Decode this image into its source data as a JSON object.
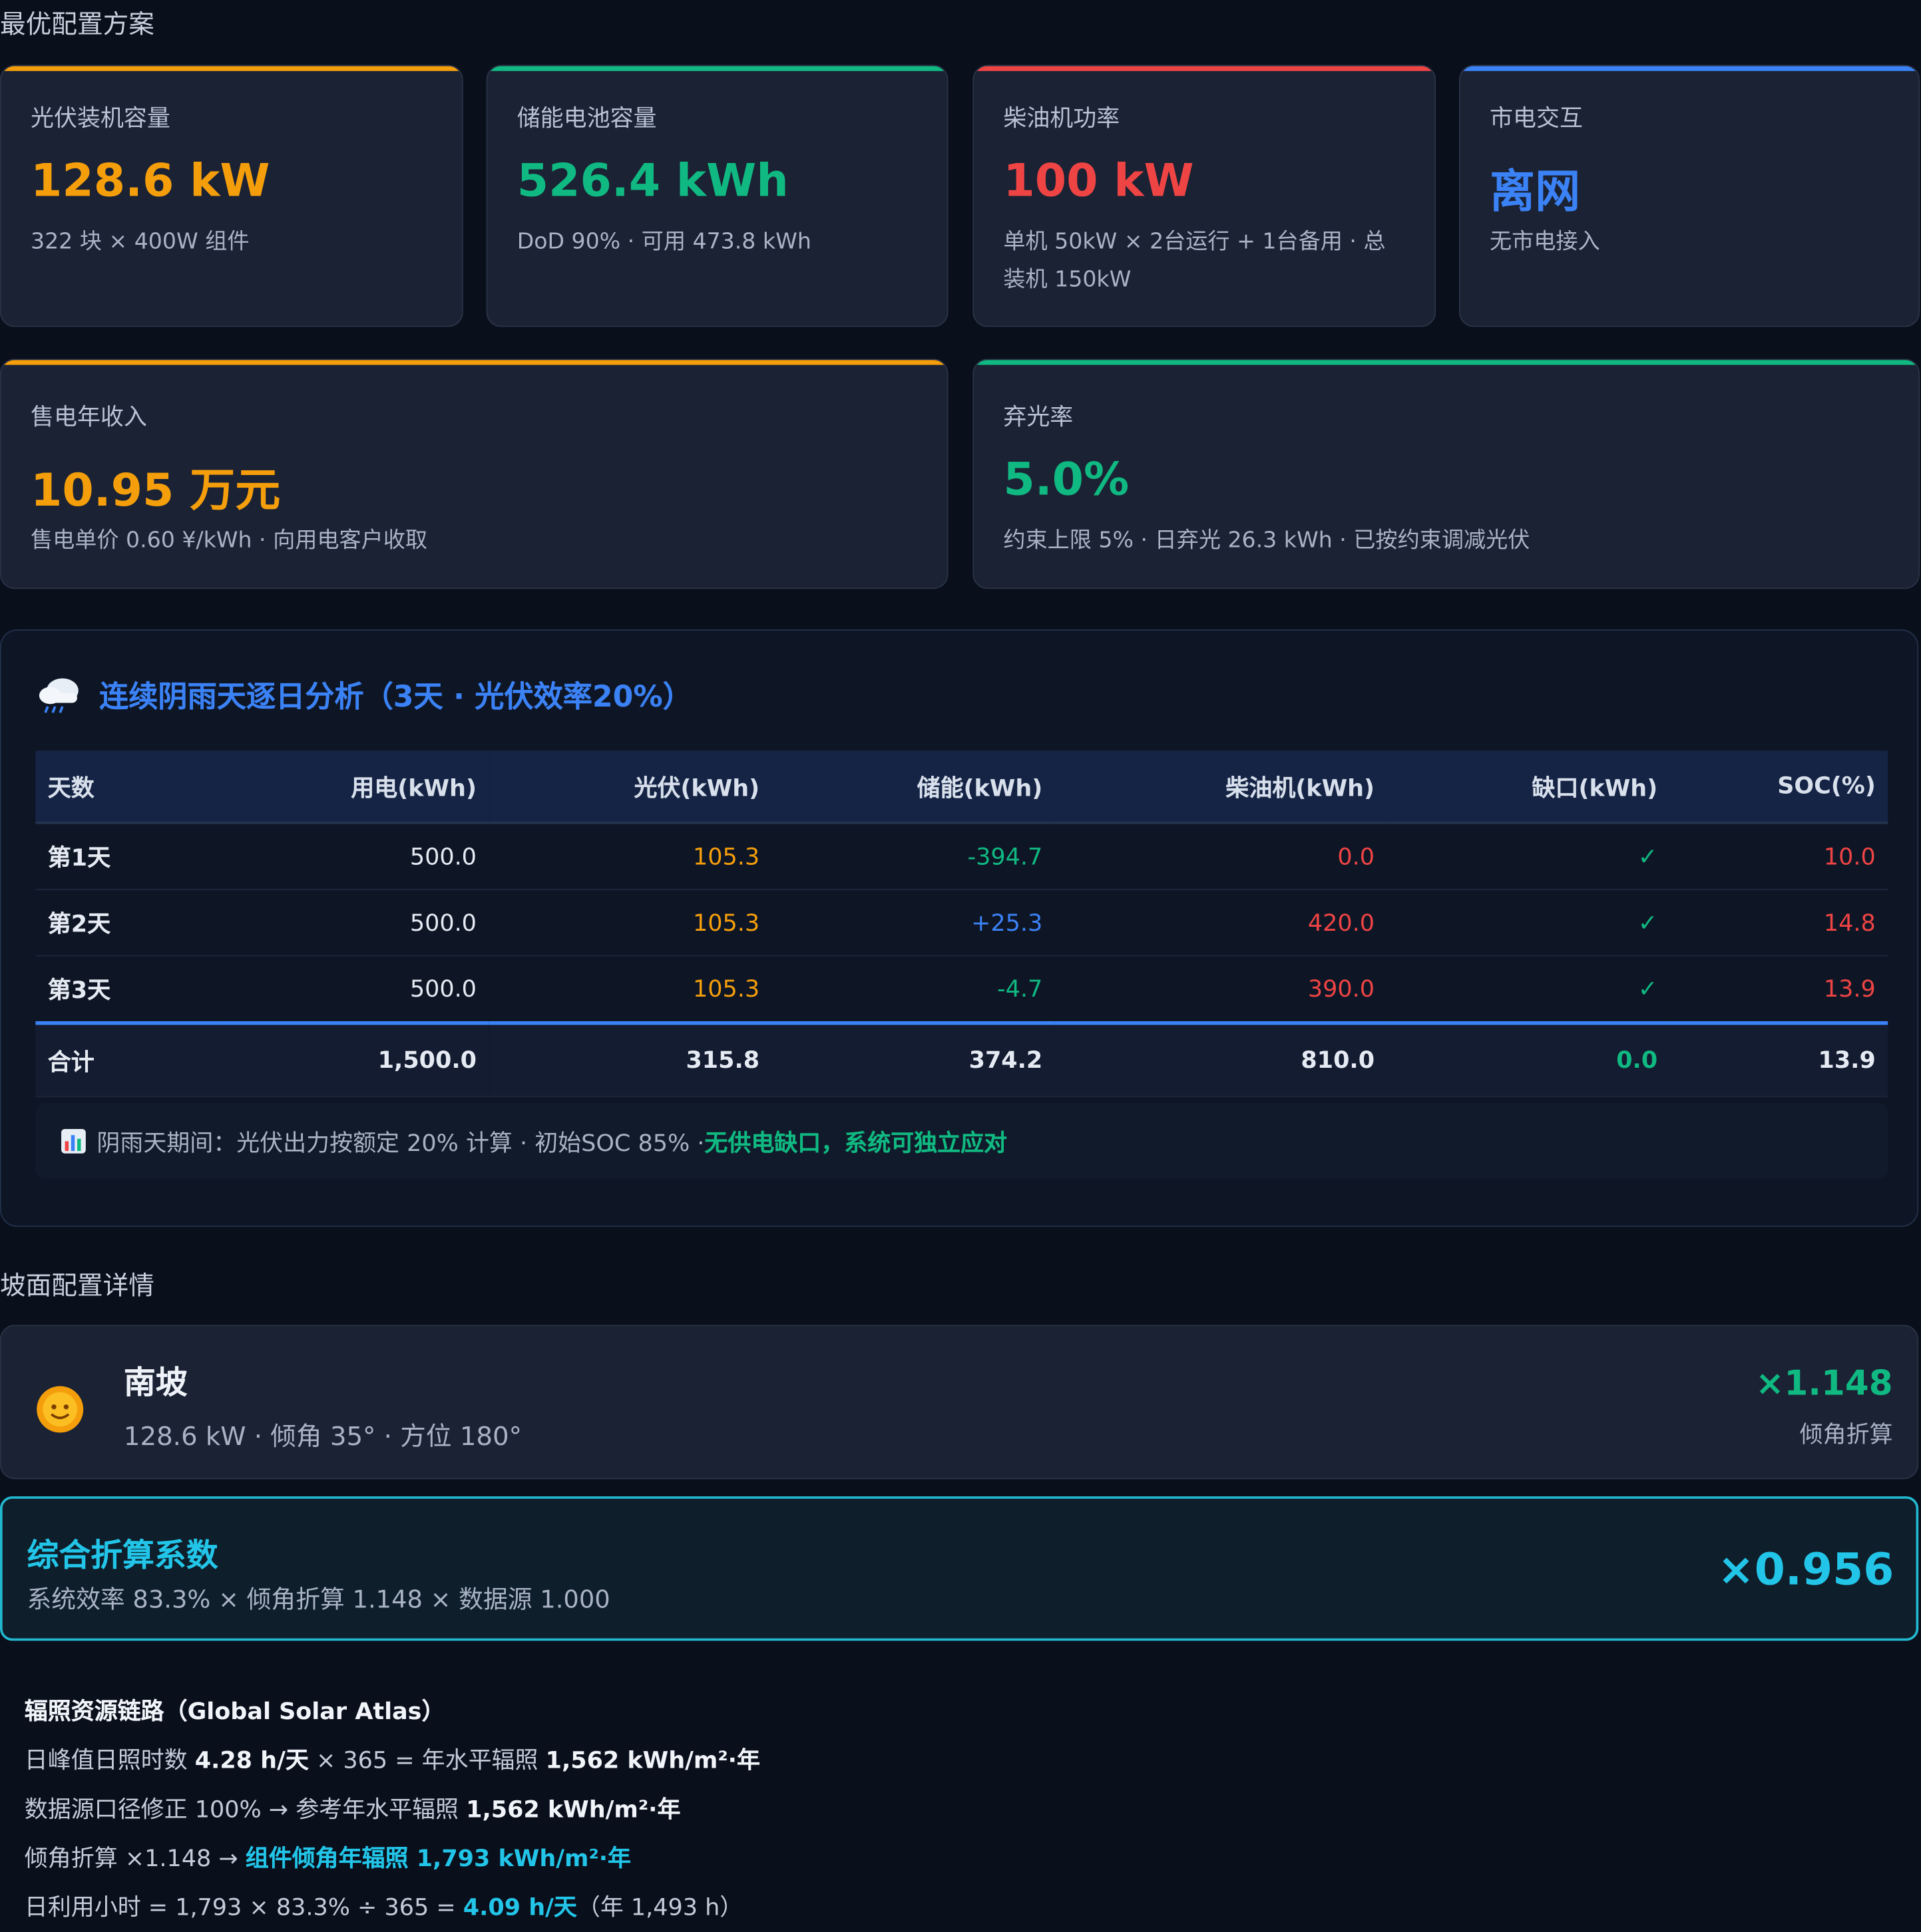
{
  "sections": {
    "optimal": "最优配置方案",
    "slope": "坡面配置详情"
  },
  "kpis": [
    {
      "label": "光伏装机容量",
      "value": "128.6 kW",
      "sub": "322 块 × 400W 组件",
      "color": "#f59e0b"
    },
    {
      "label": "储能电池容量",
      "value": "526.4 kWh",
      "sub": "DoD 90% · 可用 473.8 kWh",
      "color": "#10b981"
    },
    {
      "label": "柴油机功率",
      "value": "100 kW",
      "sub": "单机 50kW × 2台运行 + 1台备用 · 总装机 150kW",
      "color": "#ef4444"
    },
    {
      "label": "市电交互",
      "value": "离网",
      "sub": "无市电接入",
      "color": "#3b82f6"
    },
    {
      "label": "售电年收入",
      "value": "10.95 万元",
      "sub": "售电单价 0.60 ¥/kWh · 向用电客户收取",
      "color": "#f59e0b"
    },
    {
      "label": "弃光率",
      "value": "5.0%",
      "sub": "约束上限 5% · 日弃光 26.3 kWh · 已按约束调减光伏",
      "color": "#10b981"
    }
  ],
  "rainy": {
    "icon": "cloud-rain-icon",
    "title": "连续阴雨天逐日分析（3天 · 光伏效率20%）",
    "headers": [
      "天数",
      "用电(kWh)",
      "光伏(kWh)",
      "储能(kWh)",
      "柴油机(kWh)",
      "缺口(kWh)",
      "SOC(%)"
    ],
    "rows": [
      [
        "第1天",
        "500.0",
        "105.3",
        "-394.7",
        "0.0",
        "✓",
        "10.0"
      ],
      [
        "第2天",
        "500.0",
        "105.3",
        "+25.3",
        "420.0",
        "✓",
        "14.8"
      ],
      [
        "第3天",
        "500.0",
        "105.3",
        "-4.7",
        "390.0",
        "✓",
        "13.9"
      ]
    ],
    "total": [
      "合计",
      "1,500.0",
      "315.8",
      "374.2",
      "810.0",
      "0.0",
      "13.9"
    ],
    "note_prefix": "阴雨天期间：光伏出力按额定 20% 计算 · 初始SOC 85% · ",
    "note_highlight": "无供电缺口，系统可独立应对"
  },
  "slope": {
    "name": "南坡",
    "detail": "128.6 kW · 倾角 35° · 方位 180°",
    "factor": "×1.148",
    "factor_label": "倾角折算"
  },
  "combined": {
    "title": "综合折算系数",
    "detail": "系统效率 83.3% × 倾角折算 1.148 × 数据源 1.000",
    "value": "×0.956"
  },
  "irradiance": {
    "title": "辐照资源链路（Global Solar Atlas）",
    "l1a": "日峰值日照时数 ",
    "l1b": "4.28 h/天",
    "l1c": " × 365 = 年水平辐照 ",
    "l1d": "1,562 kWh/m²·年",
    "l2a": "数据源口径修正 100% → 参考年水平辐照 ",
    "l2b": "1,562 kWh/m²·年",
    "l3a": "倾角折算 ×1.148 → ",
    "l3b": "组件倾角年辐照 1,793 kWh/m²·年",
    "l4a": "日利用小时 = 1,793 × 83.3% ÷ 365 = ",
    "l4b": "4.09 h/天",
    "l4c": "（年 1,493 h）"
  },
  "colors": {
    "orange": "#f59e0b",
    "green": "#10b981",
    "red": "#ef4444",
    "blue": "#3b82f6",
    "cyan": "#22c5e8"
  }
}
